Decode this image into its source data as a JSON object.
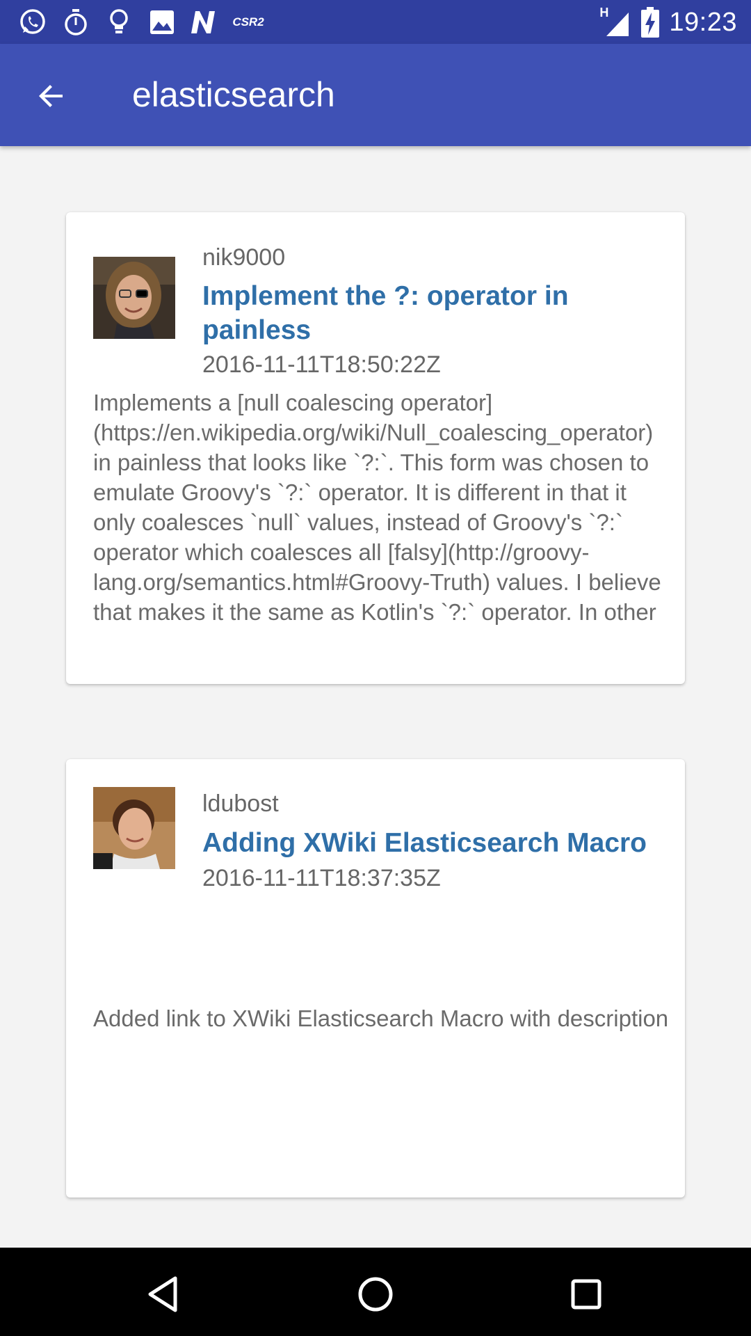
{
  "status_bar": {
    "time": "19:23",
    "network_type": "H",
    "left_icons": [
      "whatsapp-icon",
      "timer-icon",
      "lightbulb-icon",
      "image-icon",
      "n-icon",
      "csr2-icon"
    ],
    "csr_label": "CSR2",
    "right_icons": [
      "signal-icon",
      "battery-charging-icon"
    ]
  },
  "app_bar": {
    "title": "elasticsearch",
    "back_icon": "arrow-back-icon"
  },
  "feed": [
    {
      "author": "nik9000",
      "title": "Implement the ?: operator in painless",
      "date": "2016-11-11T18:50:22Z",
      "body": "Implements a [null coalescing operator](https://en.wikipedia.org/wiki/Null_coalescing_operator) in painless that looks like `?:`. This form was chosen to emulate Groovy's `?:` operator. It is different in that it only coalesces `null` values, instead of Groovy's `?:` operator which coalesces all [falsy](http://groovy-lang.org/semantics.html#Groovy-Truth) values. I believe that makes it the same as Kotlin's `?:` operator. In other"
    },
    {
      "author": "ldubost",
      "title": "Adding XWiki Elasticsearch Macro",
      "date": "2016-11-11T18:37:35Z",
      "body": "Added link to XWiki Elasticsearch Macro with description"
    }
  ],
  "nav_bar": {
    "back_icon": "nav-back-icon",
    "home_icon": "nav-home-icon",
    "recents_icon": "nav-recents-icon"
  },
  "colors": {
    "status_bar": "#303f9f",
    "app_bar": "#3f51b5",
    "title_link": "#2f6fa8",
    "background": "#f3f3f3"
  }
}
